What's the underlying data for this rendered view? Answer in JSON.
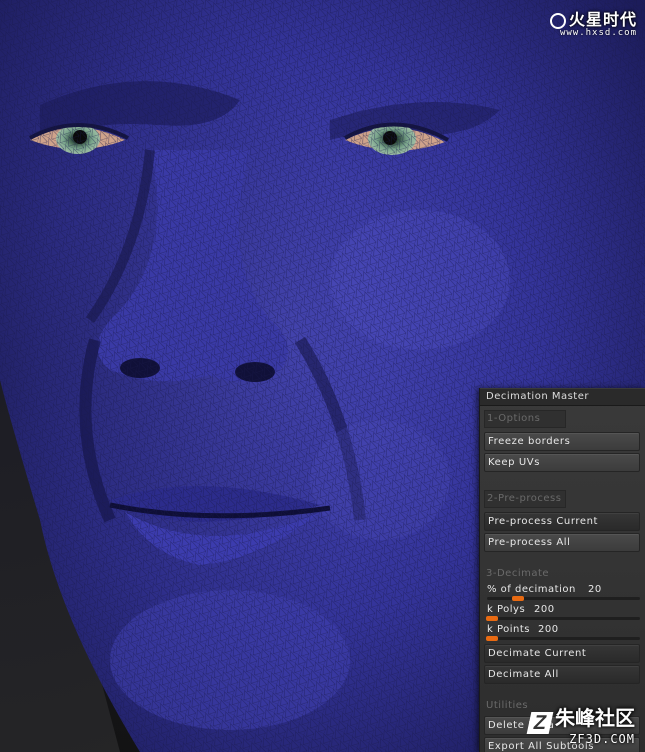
{
  "watermark_top": {
    "brand": "火星时代",
    "url": "www.hxsd.com"
  },
  "watermark_bottom": {
    "brand": "朱峰社区",
    "url": "ZF3D.COM"
  },
  "panel": {
    "title": "Decimation Master",
    "sections": {
      "options": "1-Options",
      "preprocess": "2-Pre-process",
      "decimate": "3-Decimate",
      "utilities": "Utilities"
    },
    "buttons": {
      "freeze_borders": "Freeze borders",
      "keep_uvs": "Keep UVs",
      "preprocess_current": "Pre-process Current",
      "preprocess_all": "Pre-process All",
      "decimate_current": "Decimate Current",
      "decimate_all": "Decimate All",
      "delete_data": "Delete Data",
      "export_all": "Export All Subtools"
    },
    "sliders": {
      "decimation_label": "% of decimation",
      "decimation_value": "20",
      "kpolys_label": "k Polys",
      "kpolys_value": "200",
      "kpoints_label": "k Points",
      "kpoints_value": "200"
    },
    "accent_color": "#e86a12"
  },
  "viewport": {
    "subject": "blue mesh head sculpt",
    "mesh_color": "#3a3aa8"
  }
}
